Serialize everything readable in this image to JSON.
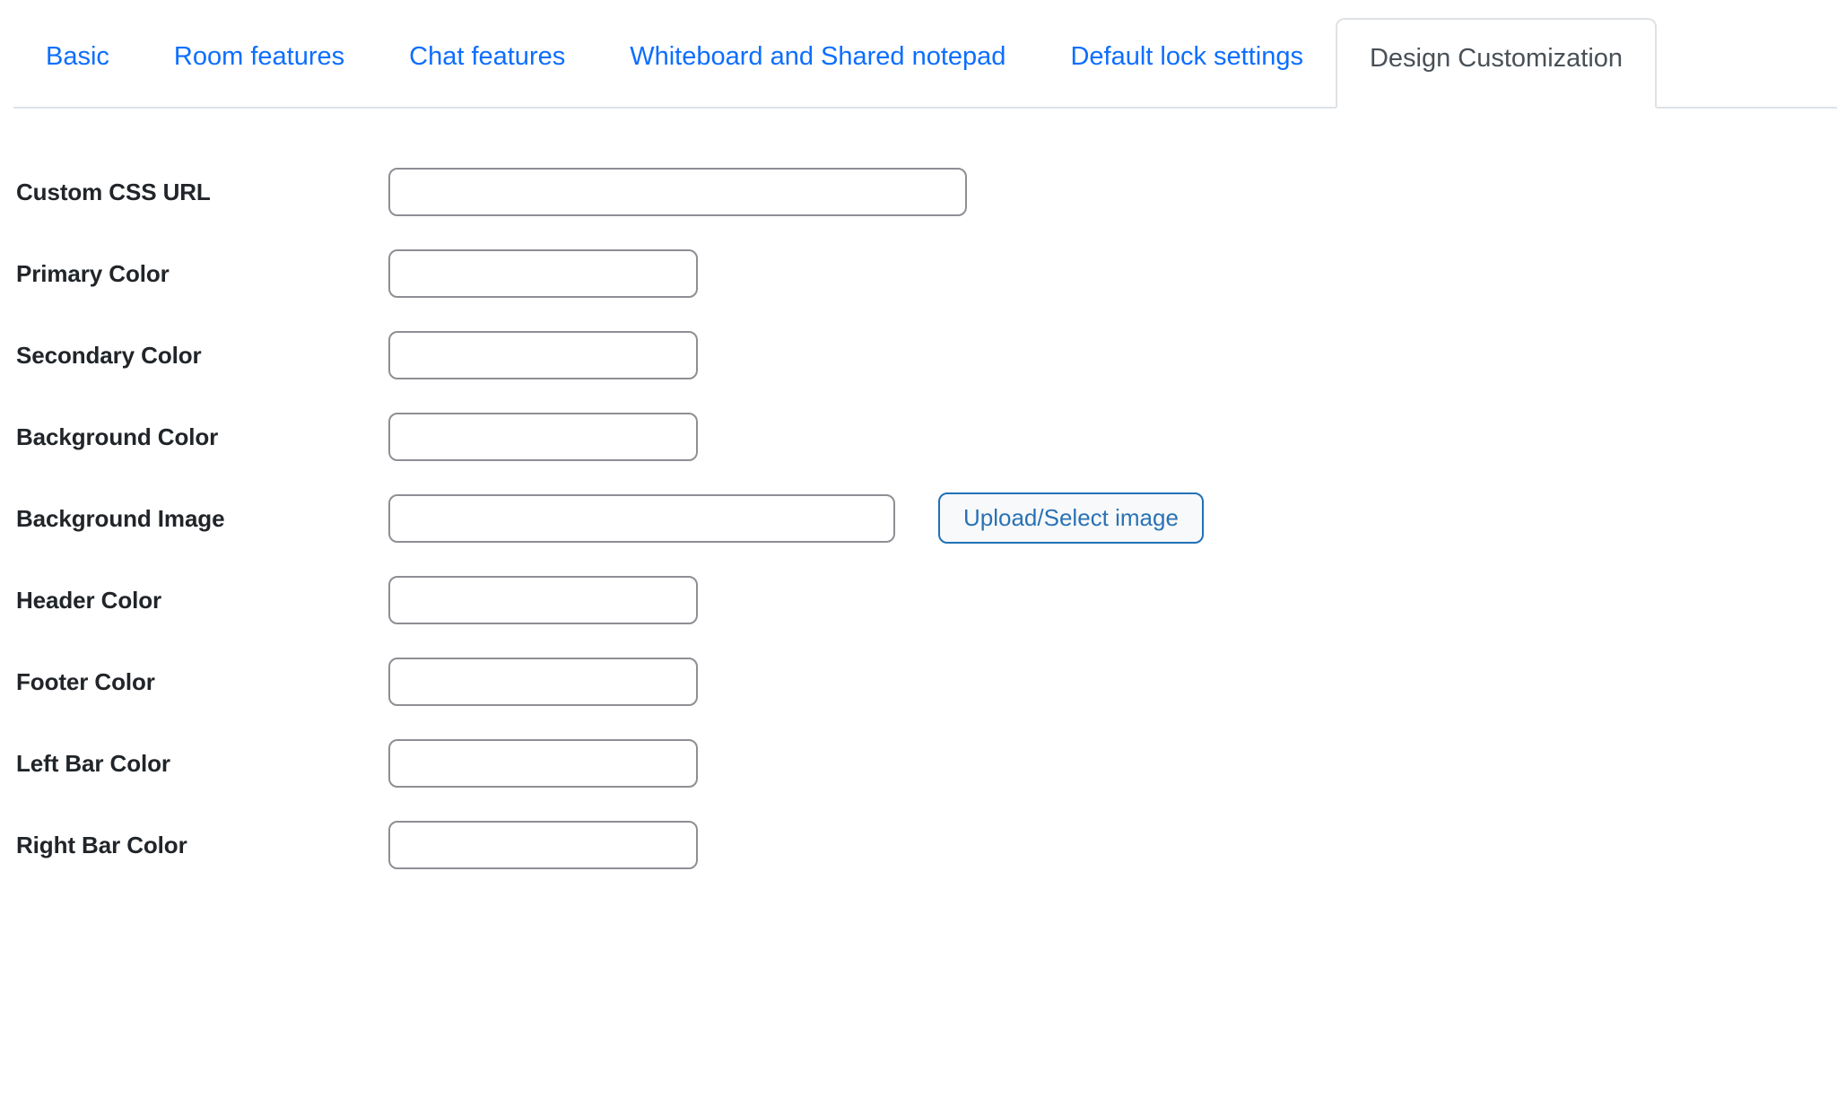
{
  "tabs": [
    {
      "label": "Basic",
      "active": false
    },
    {
      "label": "Room features",
      "active": false
    },
    {
      "label": "Chat features",
      "active": false
    },
    {
      "label": "Whiteboard and Shared notepad",
      "active": false
    },
    {
      "label": "Default lock settings",
      "active": false
    },
    {
      "label": "Design Customization",
      "active": true
    }
  ],
  "fields": [
    {
      "label": "Custom CSS URL",
      "value": "",
      "placeholder": "",
      "size": "wide"
    },
    {
      "label": "Primary Color",
      "value": "",
      "placeholder": "",
      "size": "color"
    },
    {
      "label": "Secondary Color",
      "value": "",
      "placeholder": "",
      "size": "color"
    },
    {
      "label": "Background Color",
      "value": "",
      "placeholder": "",
      "size": "color"
    },
    {
      "label": "Background Image",
      "value": "",
      "placeholder": "",
      "size": "image"
    },
    {
      "label": "Header Color",
      "value": "",
      "placeholder": "",
      "size": "color"
    },
    {
      "label": "Footer Color",
      "value": "",
      "placeholder": "",
      "size": "color"
    },
    {
      "label": "Left Bar Color",
      "value": "",
      "placeholder": "",
      "size": "color"
    },
    {
      "label": "Right Bar Color",
      "value": "",
      "placeholder": "",
      "size": "color"
    }
  ],
  "buttons": {
    "upload_select_image": "Upload/Select image"
  },
  "colors": {
    "tab_link": "#0d6efd",
    "tab_active_text": "#495057",
    "tab_border": "#dee2e6",
    "label_text": "#212529",
    "input_border": "#8d8f94",
    "button_border": "#2171b5",
    "button_text": "#2a72b5",
    "button_background": "#f8f9fa",
    "page_background": "#ffffff"
  }
}
